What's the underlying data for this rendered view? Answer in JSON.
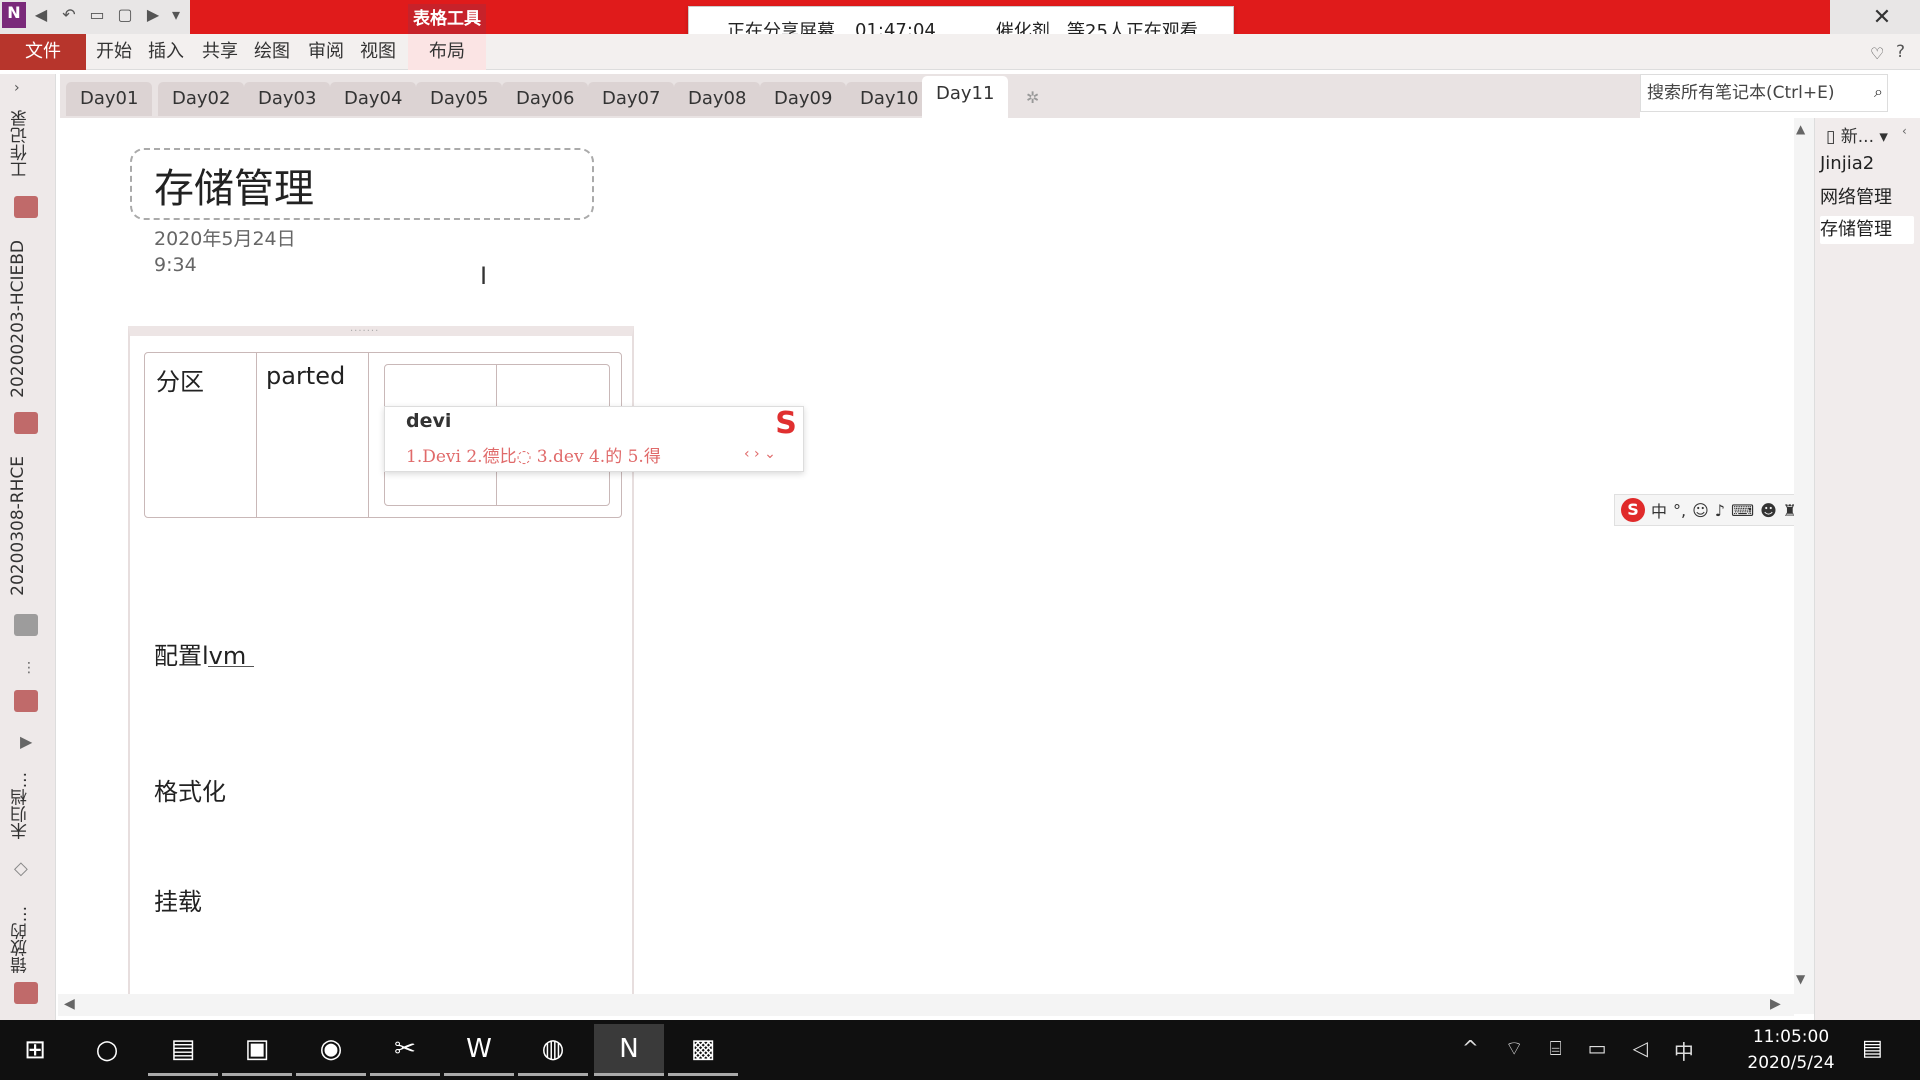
{
  "window": {
    "quick_access_icons": [
      "onenote-icon",
      "back-icon",
      "undo-icon",
      "dock-icon",
      "fullpage-icon",
      "forward-icon",
      "customize-icon"
    ],
    "table_tools_label": "表格工具",
    "close_glyph": "✕"
  },
  "share_banner": {
    "status": "正在分享屏幕",
    "duration": "01:47:04",
    "viewers": "催化剂...等25人正在观看"
  },
  "ribbon": {
    "file_label": "文件",
    "tabs": [
      "开始",
      "插入",
      "共享",
      "绘图",
      "审阅",
      "视图"
    ],
    "layout_label": "布局"
  },
  "sections": {
    "tabs": [
      "Day01",
      "Day02",
      "Day03",
      "Day04",
      "Day05",
      "Day06",
      "Day07",
      "Day08",
      "Day09",
      "Day10",
      "Day11"
    ],
    "active_index": 10
  },
  "search": {
    "placeholder": "搜索所有笔记本(Ctrl+E)"
  },
  "notebooks": {
    "items": [
      "工作记录",
      "20200203-HCIEBD",
      "20200308-RHCE",
      "未归档...",
      "错放的..."
    ]
  },
  "page": {
    "title": "存储管理",
    "date": "2020年5月24日",
    "time": "9:34",
    "table": {
      "col1": "分区",
      "col2": "parted"
    },
    "lines": [
      "配置lvm",
      "格式化",
      "挂载"
    ]
  },
  "ime_popup": {
    "input": "devi",
    "candidates": "1.Devi  2.德比◌  3.dev  4.的  5.得",
    "logo": "S"
  },
  "ime_toolbar": {
    "mode": "中",
    "punct": "°,"
  },
  "pages_panel": {
    "new_label": "新...",
    "items": [
      "Jinjia2",
      "网络管理",
      "存储管理"
    ],
    "selected_index": 2
  },
  "taskbar": {
    "time": "11:05:00",
    "date": "2020/5/24",
    "ime_indicator": "中"
  },
  "colors": {
    "accent_red": "#e01b1b",
    "file_tab": "#b7352c"
  }
}
